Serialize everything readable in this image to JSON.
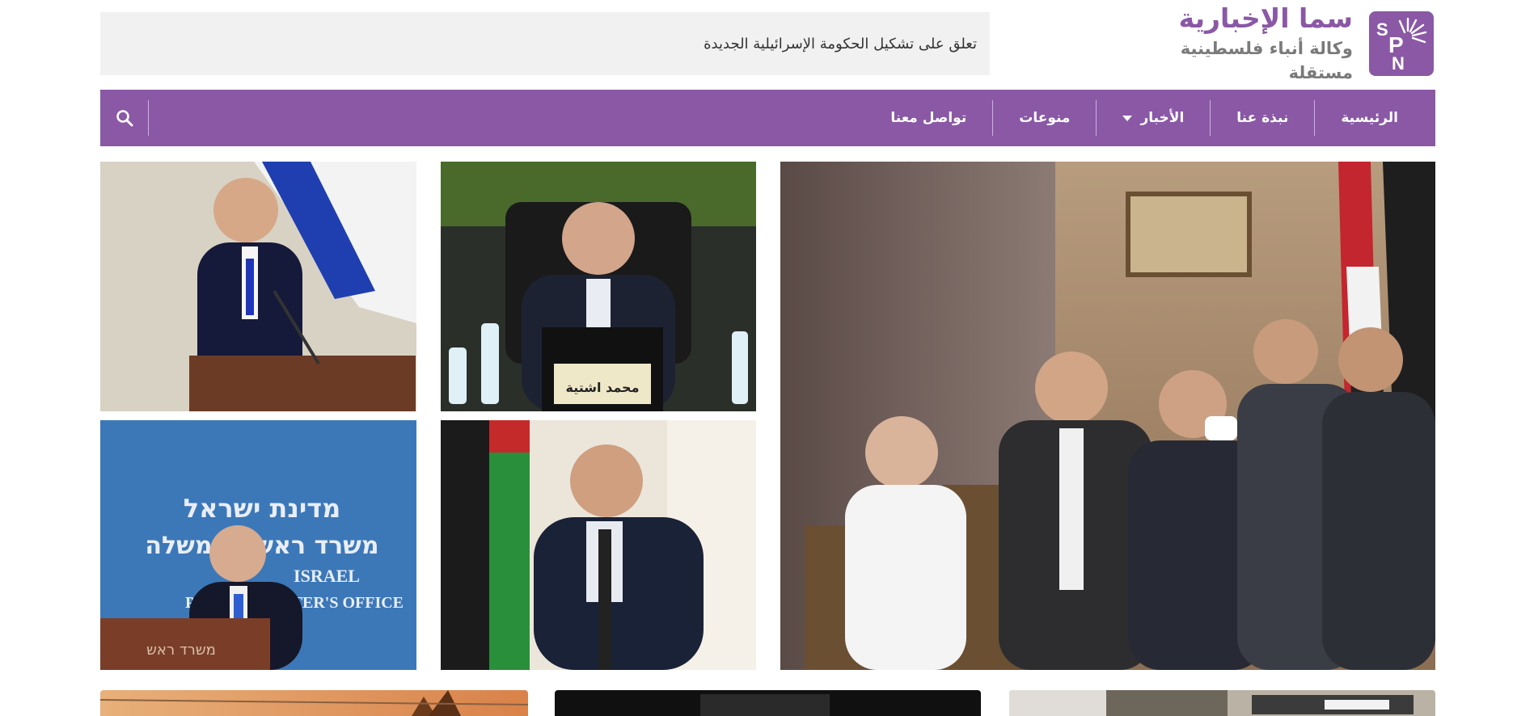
{
  "site": {
    "logo_letters": {
      "s": "S",
      "p": "P",
      "n": "N"
    },
    "title": "سما الإخبارية",
    "subtitle": "وكالة أنباء فلسطينية مستقلة"
  },
  "ticker": {
    "text": "تعلق على تشكيل الحكومة الإسرائيلية الجديدة"
  },
  "nav": {
    "items": [
      {
        "label": "الرئيسية"
      },
      {
        "label": "نبذة عنا"
      },
      {
        "label": "الأخبار",
        "has_dropdown": true
      },
      {
        "label": "منوعات"
      },
      {
        "label": "تواصل معنا"
      }
    ],
    "search_icon": "search-icon"
  },
  "photos": {
    "seal_text": "محمد اشتية",
    "sign_text_line1": "מדינת ישראל",
    "sign_text_line2": "משרד ראש הממשלה",
    "sign_text_en1": "ISRAEL",
    "sign_text_en2": "PRIME MINISTER'S OFFICE",
    "podium_text": "משרד ראש"
  },
  "colors": {
    "brand": "#8a58a5",
    "ticker_bg": "#f1f1f1",
    "subtitle": "#7a7a7a"
  }
}
